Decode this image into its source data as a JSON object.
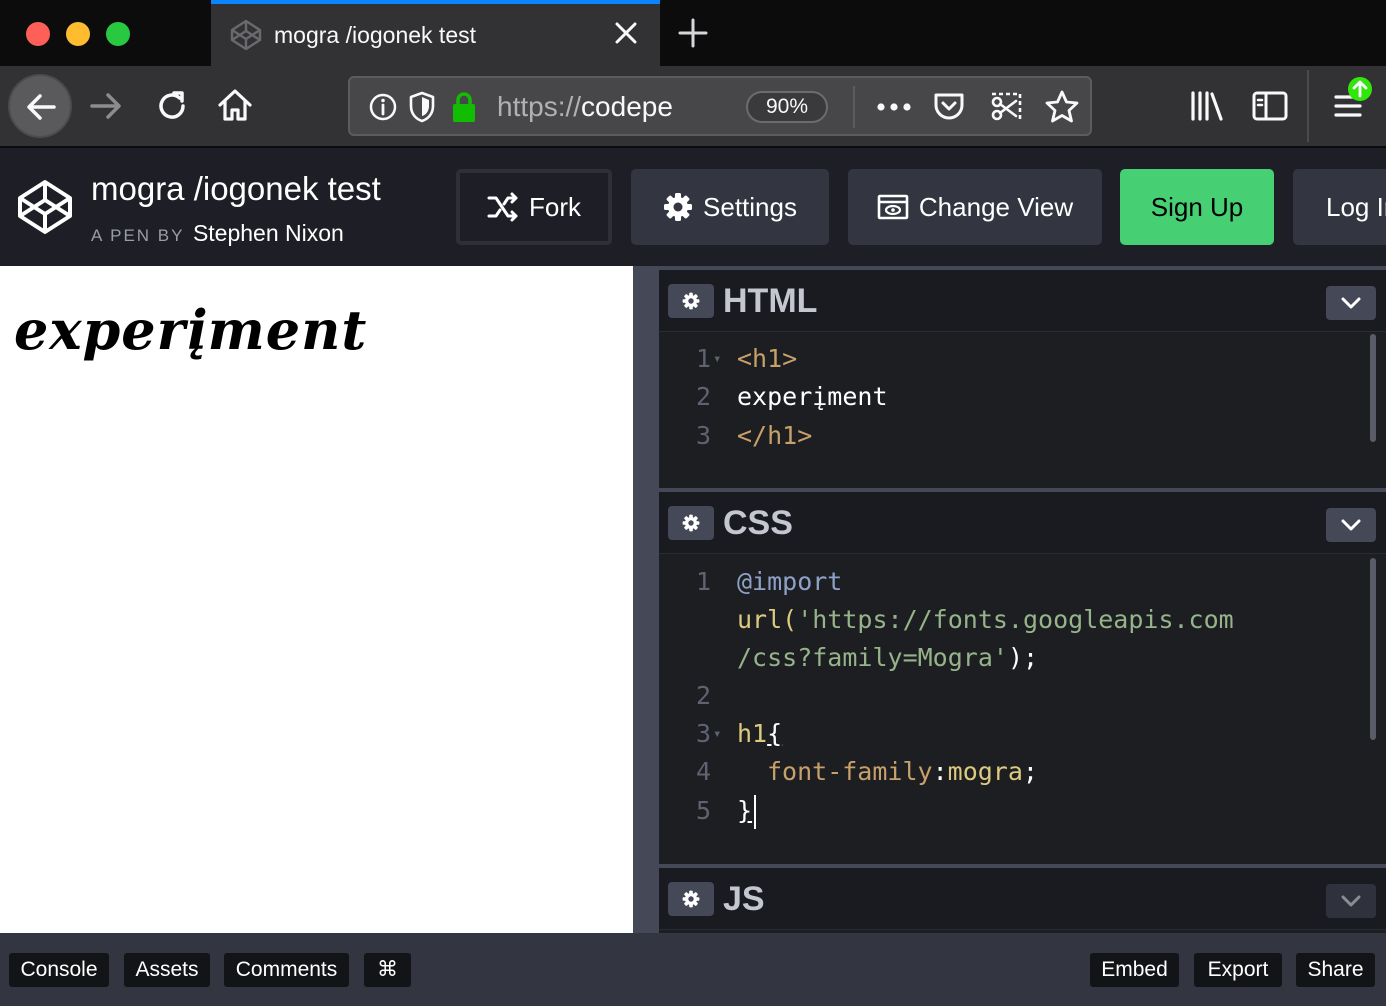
{
  "browser": {
    "tab_title": "mogra /iogonek test",
    "url_scheme": "https://",
    "url_host": "codepe",
    "zoom": "90%"
  },
  "icons": {
    "back": "arrow-left-icon",
    "forward": "arrow-right-icon",
    "reload": "reload-icon",
    "home": "home-icon",
    "info": "info-icon",
    "tracking": "shield-icon",
    "lock": "lock-icon",
    "more": "more-dots-icon",
    "pocket": "pocket-icon",
    "screenshot": "screenshot-icon",
    "bookmark": "star-icon",
    "library": "library-icon",
    "sidebar": "sidebar-icon",
    "menu": "hamburger-icon"
  },
  "colors": {
    "tab_accent": "#0a84ff",
    "signup_green": "#47cf73",
    "lock_green": "#12bc00",
    "update_badge": "#30e60b"
  },
  "header": {
    "pen_title": "mogra /iogonek test",
    "byline_prefix": "A PEN BY",
    "author": "Stephen Nixon",
    "fork_label": "Fork",
    "settings_label": "Settings",
    "change_view_label": "Change View",
    "signup_label": "Sign Up",
    "login_label": "Log In"
  },
  "preview": {
    "heading": "experįment"
  },
  "editors": {
    "html": {
      "title": "HTML",
      "lines": [
        {
          "n": "1",
          "text": "<h1>"
        },
        {
          "n": "2",
          "text": "experįment"
        },
        {
          "n": "3",
          "text": "</h1>"
        }
      ]
    },
    "css": {
      "title": "CSS",
      "line1_at": "@import",
      "line1_fn": "url(",
      "line1_str_a": "'https://fonts.googleapis.com",
      "line1_str_b": "/css?family=Mogra'",
      "line1_end": ");",
      "line3_sel": "h1",
      "line3_brace": "{",
      "line4_prop": "font-family",
      "line4_colon": ":",
      "line4_val": "mogra",
      "line4_semi": ";",
      "line5_brace": "}",
      "numbers": [
        "1",
        "2",
        "3",
        "4",
        "5"
      ]
    },
    "js": {
      "title": "JS"
    }
  },
  "footer": {
    "console": "Console",
    "assets": "Assets",
    "comments": "Comments",
    "shortcuts": "⌘",
    "embed": "Embed",
    "export": "Export",
    "share": "Share"
  }
}
